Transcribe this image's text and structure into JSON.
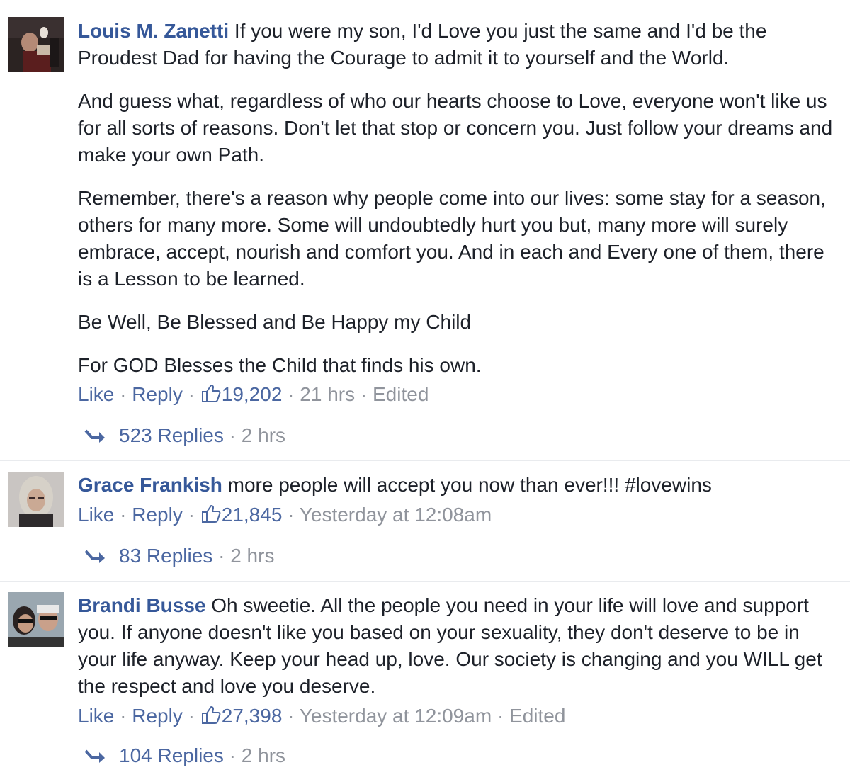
{
  "accent": "#365899",
  "link_color": "#4b67a1",
  "muted_color": "#90949c",
  "action_like": "Like",
  "action_reply": "Reply",
  "separator": "·",
  "comments": [
    {
      "author": "Louis M. Zanetti",
      "avatar_icon": "profile-photo",
      "paragraphs": [
        "If you were my son, I'd Love you just the same and I'd be the Proudest Dad for having the Courage to admit it to yourself and the World.",
        "And guess what, regardless of who our hearts choose to Love, everyone won't like us for all sorts of reasons. Don't let that stop or concern you. Just follow your dreams and make your own Path.",
        "Remember, there's a reason why people come into our lives: some stay for a season, others for many more. Some will undoubtedly hurt you but, many more will surely embrace, accept, nourish and comfort you. And in each and Every one of them, there is a Lesson to be learned.",
        "Be Well, Be Blessed and Be Happy my Child",
        "For GOD Blesses the Child that finds his own."
      ],
      "likes": "19,202",
      "time": "21 hrs",
      "edited": "Edited",
      "replies_label": "523 Replies",
      "replies_time": "2 hrs"
    },
    {
      "author": "Grace Frankish",
      "avatar_icon": "profile-photo",
      "paragraphs": [
        "more people will accept you now than ever!!! #lovewins"
      ],
      "likes": "21,845",
      "time": "Yesterday at 12:08am",
      "edited": "",
      "replies_label": "83 Replies",
      "replies_time": "2 hrs"
    },
    {
      "author": "Brandi Busse",
      "avatar_icon": "profile-photo",
      "paragraphs": [
        "Oh sweetie. All the people you need in your life will love and support you. If anyone doesn't like you based on your sexuality, they don't deserve to be in your life anyway. Keep your head up, love. Our society is changing and you WILL get the respect and love you deserve."
      ],
      "likes": "27,398",
      "time": "Yesterday at 12:09am",
      "edited": "Edited",
      "replies_label": "104 Replies",
      "replies_time": "2 hrs"
    }
  ]
}
